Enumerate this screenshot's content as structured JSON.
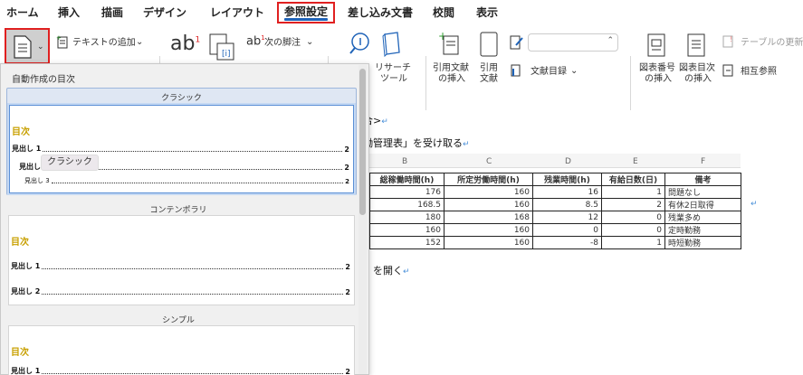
{
  "tabs": [
    "ホーム",
    "挿入",
    "描画",
    "デザイン",
    "レイアウト",
    "参照設定",
    "差し込み文書",
    "校閲",
    "表示"
  ],
  "ribbon": {
    "toc_add_text": "テキストの追加",
    "next_footnote": "次の脚注",
    "research": [
      "リサーチ",
      "ツール"
    ],
    "insert_citation": [
      "引用文献",
      "の挿入"
    ],
    "citation": [
      "引用",
      "文献"
    ],
    "bibliography": "文献目録",
    "insert_caption": [
      "図表番号",
      "の挿入"
    ],
    "insert_table_of_figures": [
      "図表目次",
      "の挿入"
    ],
    "update_table": "テーブルの更新",
    "cross_reference": "相互参照"
  },
  "panel": {
    "header": "自動作成の目次",
    "tooltip": "クラシック",
    "styles": [
      {
        "name": "クラシック",
        "title": "目次",
        "entries": [
          {
            "label": "見出し 1",
            "page": "2"
          },
          {
            "label": "見出し 2",
            "page": "2"
          },
          {
            "label": "見出し 3",
            "page": "2"
          }
        ]
      },
      {
        "name": "コンテンポラリ",
        "title": "目次",
        "entries": [
          {
            "label": "見出し 1",
            "page": "2"
          },
          {
            "label": "見出し 2",
            "page": "2"
          }
        ]
      },
      {
        "name": "シンプル",
        "title": "目次",
        "entries": [
          {
            "label": "見出し 1",
            "page": "2"
          }
        ]
      }
    ]
  },
  "document": {
    "line1": "合>",
    "line2": "働管理表」を受け取る",
    "line3": "」を開く",
    "col_letters": [
      "B",
      "C",
      "D",
      "E",
      "F"
    ],
    "headers": [
      "総稼働時間(h)",
      "所定労働時間(h)",
      "残業時間(h)",
      "有給日数(日)",
      "備考"
    ],
    "rows": [
      [
        "176",
        "160",
        "16",
        "1",
        "問題なし"
      ],
      [
        "168.5",
        "160",
        "8.5",
        "2",
        "有休2日取得"
      ],
      [
        "180",
        "168",
        "12",
        "0",
        "残業多め"
      ],
      [
        "160",
        "160",
        "0",
        "0",
        "定時勤務"
      ],
      [
        "152",
        "160",
        "-8",
        "1",
        "時短勤務"
      ]
    ]
  },
  "colors": {
    "accent": "#1f63b8",
    "highlight": "#e02020",
    "toc_gold": "#c8a000"
  }
}
